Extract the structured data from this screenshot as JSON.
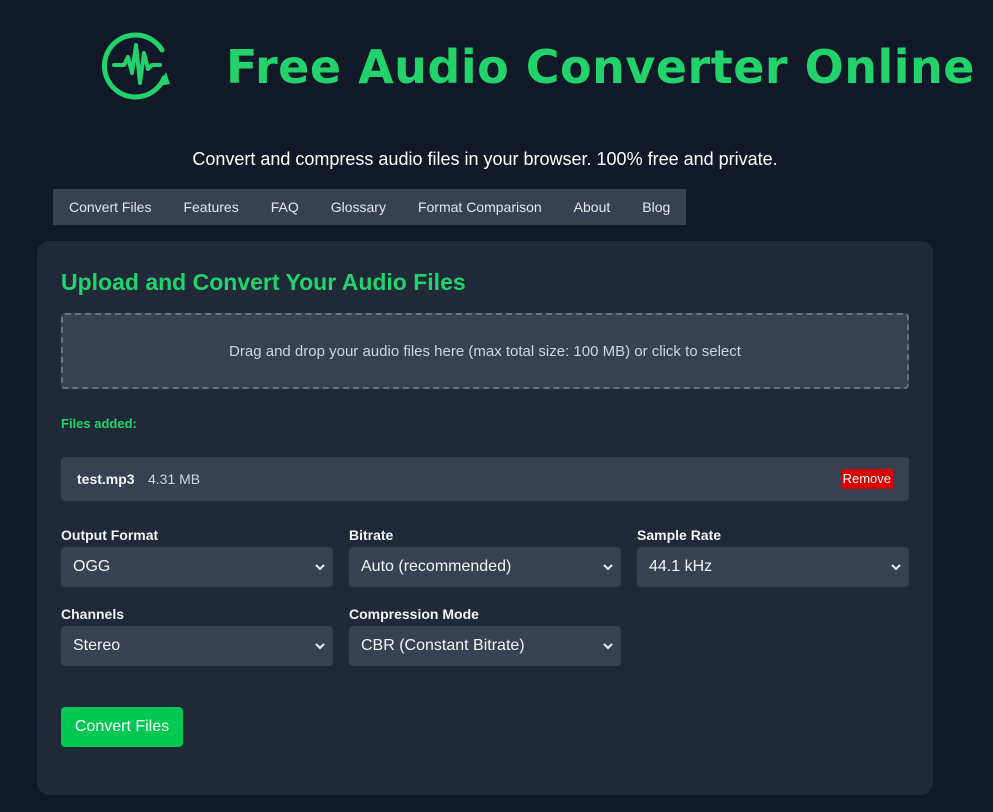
{
  "header": {
    "title": "Free Audio Converter Online",
    "tagline": "Convert and compress audio files in your browser. 100% free and private.",
    "logo_icon": "waveform-circle-icon",
    "brand_color": "#22d36b"
  },
  "nav": {
    "items": [
      "Convert Files",
      "Features",
      "FAQ",
      "Glossary",
      "Format Comparison",
      "About",
      "Blog"
    ]
  },
  "upload": {
    "title": "Upload and Convert Your Audio Files",
    "dropzone_text": "Drag and drop your audio files here (max total size: 100 MB) or click to select",
    "files_label": "Files added:",
    "files": [
      {
        "name": "test.mp3",
        "size": "4.31 MB",
        "remove_label": "Remove"
      }
    ]
  },
  "options": {
    "output_format": {
      "label": "Output Format",
      "value": "OGG"
    },
    "bitrate": {
      "label": "Bitrate",
      "value": "Auto (recommended)"
    },
    "sample_rate": {
      "label": "Sample Rate",
      "value": "44.1 kHz"
    },
    "channels": {
      "label": "Channels",
      "value": "Stereo"
    },
    "compression_mode": {
      "label": "Compression Mode",
      "value": "CBR (Constant Bitrate)"
    }
  },
  "actions": {
    "convert_label": "Convert Files"
  },
  "colors": {
    "background": "#111827",
    "card": "#1f2937",
    "field": "#374151",
    "accent": "#22d36b",
    "button": "#00c853",
    "danger": "#d90000"
  }
}
